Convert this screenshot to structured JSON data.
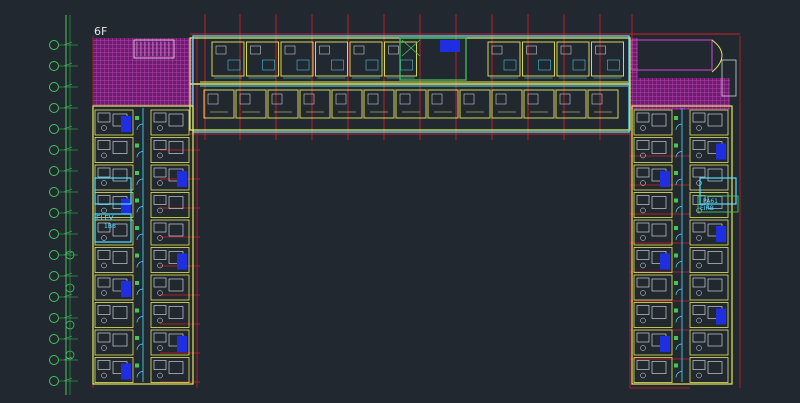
{
  "drawing": {
    "floor_label": "6F",
    "elevator_label": "ELEV",
    "elevator_sub": "1BB",
    "right_label": "PA61",
    "right_sub": "EIRB",
    "colors": {
      "background": "#212830",
      "wall_yellow": "#e8e85a",
      "wall_cyan": "#4fe0ff",
      "axis_red": "#d21e2a",
      "hatch_magenta": "#b43cb4",
      "grid_green": "#41c85a",
      "room_blue": "#1e2ee0",
      "furniture_white": "#e8e8e8"
    }
  }
}
